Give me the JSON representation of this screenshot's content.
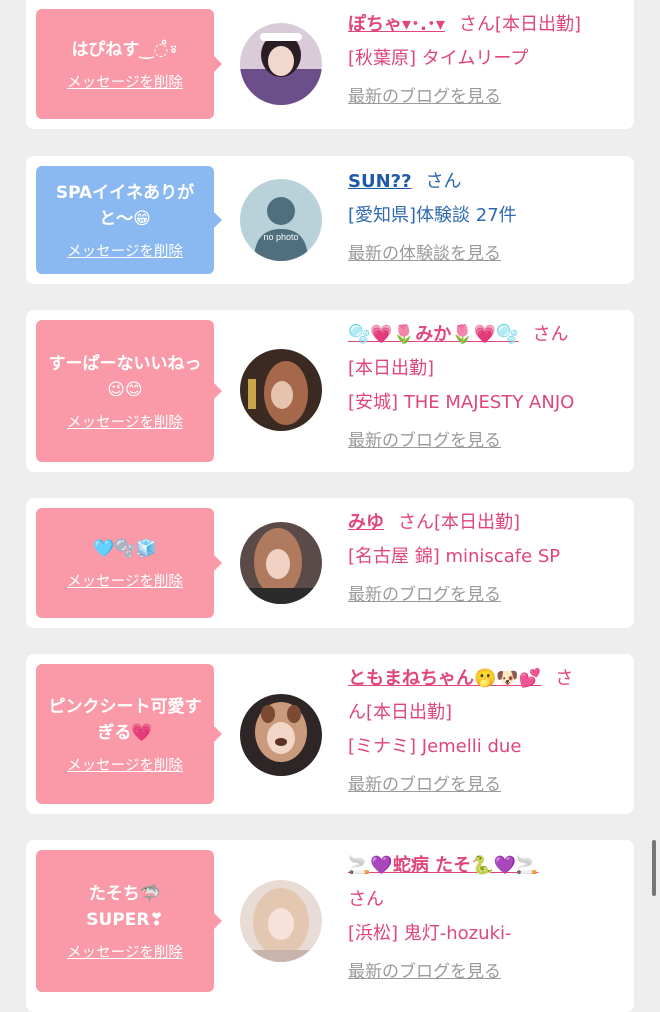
{
  "items": [
    {
      "message": "はぴねす‿◌̊⍤",
      "delete_label": "メッセージを削除",
      "name": "ぽちゃ▾･.･▾",
      "san": "さん",
      "status": "[本日出勤]",
      "meta": "[秋葉原] タイムリープ",
      "link": "最新のブログを見る"
    },
    {
      "message": "SPAイイネありがと〜😁",
      "delete_label": "メッセージを削除",
      "name": "SUN??",
      "san": "さん",
      "meta": "[愛知県]体験談 27件",
      "link": "最新の体験談を見る",
      "avatar_text": "no photo"
    },
    {
      "message": "すーぱーないいねっ😉😊",
      "delete_label": "メッセージを削除",
      "name": "🫧💗🌷みか🌷💗🫧",
      "san": "さん",
      "status": "[本日出勤]",
      "meta": "[安城] THE MAJESTY ANJO",
      "link": "最新のブログを見る"
    },
    {
      "message": "🩵🫧🧊",
      "delete_label": "メッセージを削除",
      "name": "みゆ",
      "san": "さん",
      "status": "[本日出勤]",
      "meta": "[名古屋 錦] miniscafe SP",
      "link": "最新のブログを見る"
    },
    {
      "message": "ピンクシート可愛すぎる💗",
      "delete_label": "メッセージを削除",
      "name": "ともまねちゃん🫢🐶💕",
      "san": "さ",
      "status": "ん[本日出勤]",
      "meta": "[ミナミ] Jemelli due",
      "link": "最新のブログを見る"
    },
    {
      "message": "たそち🦈\nSUPER❣",
      "delete_label": "メッセージを削除",
      "name": "🚬💜蛇病 たそ🐍💜🚬",
      "san": "さん",
      "meta": "[浜松] 鬼灯-hozuki-",
      "link": "最新のブログを見る"
    }
  ]
}
